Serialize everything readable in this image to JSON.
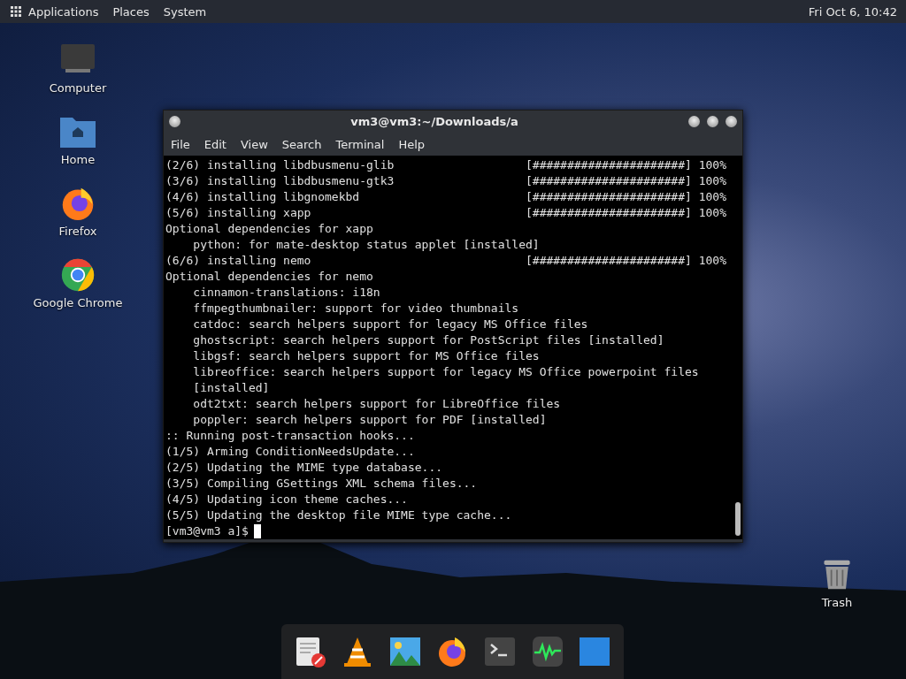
{
  "top_panel": {
    "menus": [
      "Applications",
      "Places",
      "System"
    ],
    "clock": "Fri Oct  6, 10:42"
  },
  "desktop_icons": [
    {
      "label": "Computer",
      "kind": "computer"
    },
    {
      "label": "Home",
      "kind": "home"
    },
    {
      "label": "Firefox",
      "kind": "firefox"
    },
    {
      "label": "Google Chrome",
      "kind": "chrome"
    }
  ],
  "trash": {
    "label": "Trash"
  },
  "window": {
    "title": "vm3@vm3:~/Downloads/a",
    "menu": [
      "File",
      "Edit",
      "View",
      "Search",
      "Terminal",
      "Help"
    ],
    "lines": [
      {
        "text": "(2/6) installing libdbusmenu-glib",
        "progress": "[######################] 100%"
      },
      {
        "text": "(3/6) installing libdbusmenu-gtk3",
        "progress": "[######################] 100%"
      },
      {
        "text": "(4/6) installing libgnomekbd",
        "progress": "[######################] 100%"
      },
      {
        "text": "(5/6) installing xapp",
        "progress": "[######################] 100%"
      },
      {
        "text": "Optional dependencies for xapp"
      },
      {
        "text": "    python: for mate-desktop status applet [installed]"
      },
      {
        "text": "(6/6) installing nemo",
        "progress": "[######################] 100%"
      },
      {
        "text": "Optional dependencies for nemo"
      },
      {
        "text": "    cinnamon-translations: i18n"
      },
      {
        "text": "    ffmpegthumbnailer: support for video thumbnails"
      },
      {
        "text": "    catdoc: search helpers support for legacy MS Office files"
      },
      {
        "text": "    ghostscript: search helpers support for PostScript files [installed]"
      },
      {
        "text": "    libgsf: search helpers support for MS Office files"
      },
      {
        "text": "    libreoffice: search helpers support for legacy MS Office powerpoint files"
      },
      {
        "text": "    [installed]"
      },
      {
        "text": "    odt2txt: search helpers support for LibreOffice files"
      },
      {
        "text": "    poppler: search helpers support for PDF [installed]"
      },
      {
        "text": ":: Running post-transaction hooks..."
      },
      {
        "text": "(1/5) Arming ConditionNeedsUpdate..."
      },
      {
        "text": "(2/5) Updating the MIME type database..."
      },
      {
        "text": "(3/5) Compiling GSettings XML schema files..."
      },
      {
        "text": "(4/5) Updating icon theme caches..."
      },
      {
        "text": "(5/5) Updating the desktop file MIME type cache..."
      }
    ],
    "prompt": "[vm3@vm3 a]$"
  },
  "dock": [
    {
      "kind": "editor"
    },
    {
      "kind": "vlc"
    },
    {
      "kind": "photos"
    },
    {
      "kind": "firefox"
    },
    {
      "kind": "terminal"
    },
    {
      "kind": "monitor"
    },
    {
      "kind": "files"
    }
  ]
}
